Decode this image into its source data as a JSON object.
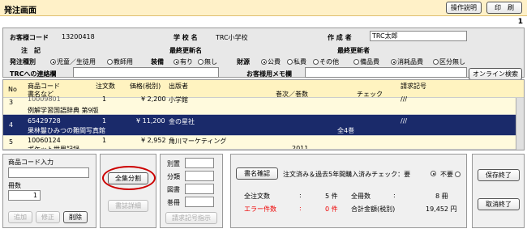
{
  "window": {
    "title": "発注画面"
  },
  "toolbar": {
    "help": "操作説明",
    "print": "印　刷"
  },
  "page": {
    "number": "1"
  },
  "customer": {
    "code_label": "お客様コード",
    "code": "13200418",
    "school_label": "学 校 名",
    "school": "TRC小学校",
    "creator_label": "作 成 者",
    "creator": "TRC太郎"
  },
  "notes": {
    "label": "注　記",
    "last_updated_label": "最終更新名",
    "last_updater_label": "最終更新者"
  },
  "order_type": {
    "label": "発注種別",
    "options": [
      "児童／生徒用",
      "教師用"
    ],
    "selected": 0
  },
  "binding": {
    "label": "装備",
    "options": [
      "有り",
      "無し"
    ],
    "selected": 0
  },
  "funds": {
    "label": "財源",
    "options": [
      "公費",
      "私費",
      "その他"
    ],
    "selected": 0
  },
  "item_category": {
    "options": [
      "備品費",
      "消耗品費",
      "区分無し"
    ],
    "selected": 1
  },
  "contact": {
    "label": "TRCへの連絡欄",
    "memo_label": "お客様用メモ欄",
    "online_button": "オンライン検索"
  },
  "table": {
    "headers": {
      "no": "No",
      "code": "商品コード",
      "title": "書名など",
      "qty": "注文数",
      "price": "価格(税別)",
      "publisher": "出版者",
      "volume": "巻次／巻数",
      "check": "チェック",
      "request": "請求記号"
    },
    "rows": [
      {
        "no": "3",
        "code": "10009801",
        "qty": "1",
        "price": "¥ 2,200",
        "publisher": "小学館",
        "title": "例解学習国語辞典 第9版",
        "volume": "",
        "request": "///"
      },
      {
        "no": "4",
        "code": "65429728",
        "qty": "1",
        "price": "¥ 11,200",
        "publisher": "金の星社",
        "title": "果林鬘ひみつの難間写真館",
        "volume": "全4巻",
        "request": "///"
      },
      {
        "no": "5",
        "code": "10060124",
        "qty": "1",
        "price": "¥ 2,952",
        "publisher": "角川マーケティング",
        "title": "ポケット世界記録",
        "volume": "2011",
        "request": ""
      }
    ]
  },
  "entry": {
    "code_label": "商品コード入力",
    "qty_label": "冊数",
    "qty": "1",
    "add": "追加",
    "modify": "修正",
    "delete": "削除"
  },
  "split": {
    "all_split": "全集分割",
    "detail": "書誌詳細"
  },
  "classification": {
    "labels": [
      "別置",
      "分類",
      "図書",
      "巻冊"
    ],
    "request_button": "請求記号指示"
  },
  "summary": {
    "confirm_button": "書名確認",
    "check_text": "注文済み＆過去5年間購入済みチェック：要",
    "not_needed": "不要",
    "total_orders_label": "全注文数",
    "total_orders": "5 件",
    "total_books_label": "全冊数",
    "total_books": "8 冊",
    "errors_label": "エラー件数",
    "errors": "0 件",
    "total_amount_label": "合計金額(税別)",
    "total_amount": "19,452 円"
  },
  "actions": {
    "save": "保存終了",
    "cancel": "取消終了"
  }
}
